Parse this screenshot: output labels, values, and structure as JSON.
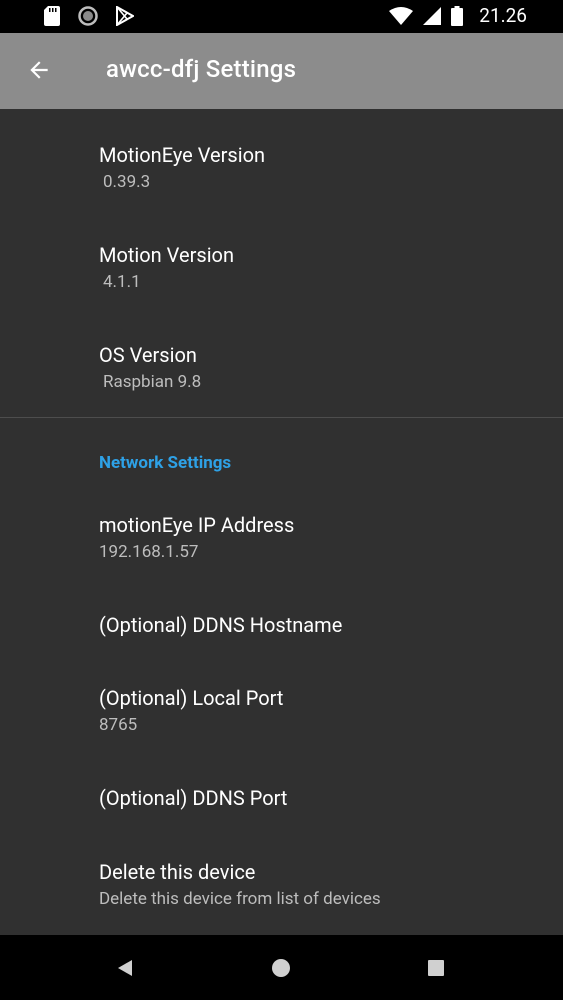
{
  "status_bar": {
    "time": "21.26",
    "left_icons": [
      "sd-card-icon",
      "sync-circle-icon",
      "play-store-icon"
    ],
    "right_icons": [
      "wifi-icon",
      "signal-icon",
      "battery-icon"
    ]
  },
  "app_bar": {
    "title": "awcc-dfj Settings",
    "background": "#8c8c8c"
  },
  "preferences": {
    "motioneye_version": {
      "title": "MotionEye Version",
      "summary": "0.39.3"
    },
    "motion_version": {
      "title": "Motion Version",
      "summary": "4.1.1"
    },
    "os_version": {
      "title": "OS Version",
      "summary": "Raspbian 9.8"
    }
  },
  "network": {
    "category_title": "Network Settings",
    "accent": "#2ea1e6",
    "ip_address": {
      "title": "motionEye IP Address",
      "summary": "192.168.1.57"
    },
    "ddns_hostname": {
      "title": "(Optional) DDNS Hostname"
    },
    "local_port": {
      "title": "(Optional) Local Port",
      "summary": "8765"
    },
    "ddns_port": {
      "title": "(Optional) DDNS Port"
    }
  },
  "delete_device": {
    "title": "Delete this device",
    "summary": "Delete this device from list of devices"
  },
  "nav_bar": {
    "buttons": [
      "back-triangle-icon",
      "home-circle-icon",
      "recents-square-icon"
    ]
  }
}
